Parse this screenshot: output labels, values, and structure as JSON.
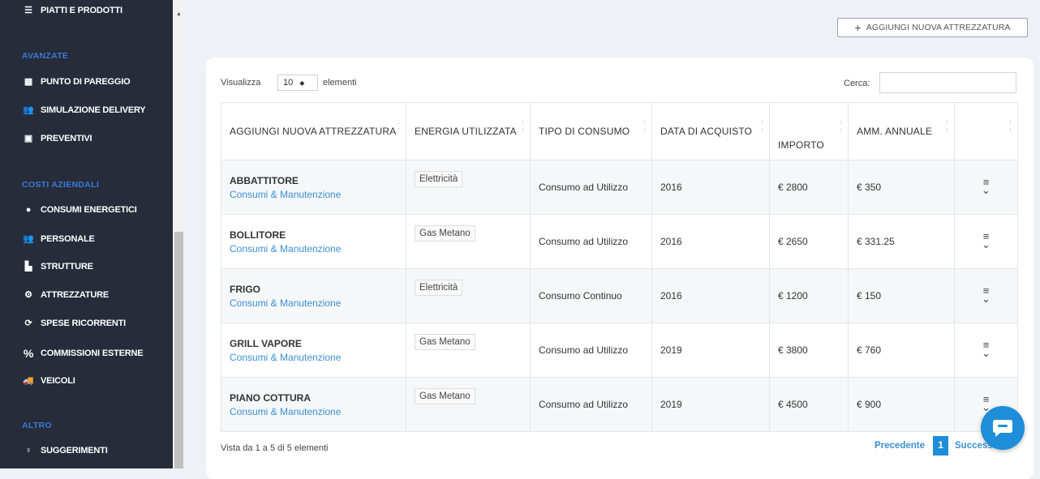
{
  "sidebar": {
    "top_item": "PIATTI E PRODOTTI",
    "section_advanced": "AVANZATE",
    "advanced_items": [
      {
        "label": "PUNTO DI PAREGGIO",
        "icon": "calculator-icon"
      },
      {
        "label": "SIMULAZIONE DELIVERY",
        "icon": "users-icon"
      },
      {
        "label": "PREVENTIVI",
        "icon": "id-card-icon"
      }
    ],
    "section_costs": "COSTI AZIENDALI",
    "cost_items": [
      {
        "label": "CONSUMI ENERGETICI",
        "icon": "drop-icon"
      },
      {
        "label": "PERSONALE",
        "icon": "team-icon"
      },
      {
        "label": "STRUTTURE",
        "icon": "building-icon"
      },
      {
        "label": "ATTREZZATURE",
        "icon": "gears-icon"
      },
      {
        "label": "SPESE RICORRENTI",
        "icon": "sync-icon"
      },
      {
        "label": "COMMISSIONI ESTERNE",
        "icon": "percent-icon"
      },
      {
        "label": "VEICOLI",
        "icon": "truck-icon"
      }
    ],
    "section_other": "ALTRO",
    "other_items": [
      {
        "label": "SUGGERIMENTI",
        "icon": "lightbulb-icon"
      }
    ]
  },
  "toolbar": {
    "add_label": "AGGIUNGI NUOVA ATTREZZATURA"
  },
  "controls": {
    "show_label": "Visualizza",
    "page_length": "10",
    "elements_label": "elementi",
    "search_label": "Cerca:",
    "search_value": ""
  },
  "table": {
    "columns": [
      "AGGIUNGI NUOVA ATTREZZATURA",
      "ENERGIA UTILIZZATA",
      "TIPO DI CONSUMO",
      "DATA DI ACQUISTO",
      "IMPORTO",
      "AMM. ANNUALE",
      ""
    ],
    "rows": [
      {
        "name": "ABBATTITORE",
        "link": "Consumi & Manutenzione",
        "energy": "Elettricità",
        "consumption": "Consumo ad Utilizzo",
        "year": "2016",
        "amount": "€ 2800",
        "annual": "€ 350"
      },
      {
        "name": "BOLLITORE",
        "link": "Consumi & Manutenzione",
        "energy": "Gas Metano",
        "consumption": "Consumo ad Utilizzo",
        "year": "2016",
        "amount": "€ 2650",
        "annual": "€ 331.25"
      },
      {
        "name": "FRIGO",
        "link": "Consumi & Manutenzione",
        "energy": "Elettricità",
        "consumption": "Consumo Continuo",
        "year": "2016",
        "amount": "€ 1200",
        "annual": "€ 150"
      },
      {
        "name": "GRILL VAPORE",
        "link": "Consumi & Manutenzione",
        "energy": "Gas Metano",
        "consumption": "Consumo ad Utilizzo",
        "year": "2019",
        "amount": "€ 3800",
        "annual": "€ 760"
      },
      {
        "name": "PIANO COTTURA",
        "link": "Consumi & Manutenzione",
        "energy": "Gas Metano",
        "consumption": "Consumo ad Utilizzo",
        "year": "2019",
        "amount": "€ 4500",
        "annual": "€ 900"
      }
    ]
  },
  "footer": {
    "info": "Vista da 1 a 5 di 5 elementi",
    "prev_label": "Precedente",
    "current_page": "1",
    "next_label": "Successivo"
  },
  "colors": {
    "sidebar_bg": "#262c3a",
    "section_heading": "#3a7bd5",
    "accent": "#1e8ed8",
    "link": "#3a8fd4"
  }
}
